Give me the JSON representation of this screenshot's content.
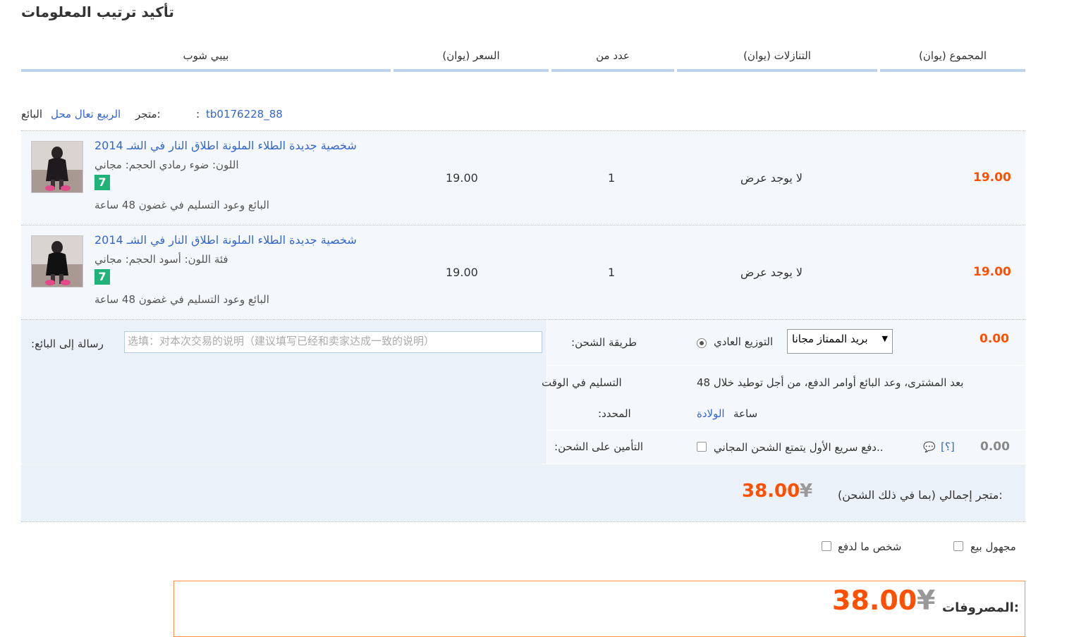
{
  "page_title": "تأكيد ترتيب المعلومات",
  "columns": {
    "total": "(المجموع (يوان",
    "discounts": "(التنازلات (يوان",
    "quantity": "عدد من",
    "price": "(السعر (يوان",
    "product": "بيبي شوب"
  },
  "seller": {
    "store_prefix": "متجر:",
    "store_name": "الربيع تعال محل",
    "seller_label": "البائع",
    "seller_id": "tb0176228_88",
    "colon": ":"
  },
  "items": [
    {
      "title": "شخصية جديدة الطلاء الملونة اطلاق النار في الشـ 2014",
      "attrs": "اللون: ضوء رمادي   الحجم: مجاني",
      "badge": "7",
      "note": "البائع وعود التسليم في غضون 48 ساعة",
      "price": "19.00",
      "quantity": "1",
      "discount": "لا يوجد عرض",
      "total": "19.00"
    },
    {
      "title": "شخصية جديدة الطلاء الملونة اطلاق النار في الشـ 2014",
      "attrs": "فئة اللون: أسود   الحجم: مجاني",
      "badge": "7",
      "note": "البائع وعود التسليم في غضون 48 ساعة",
      "price": "19.00",
      "quantity": "1",
      "discount": "لا يوجد عرض",
      "total": "19.00"
    }
  ],
  "message": {
    "label": ":رسالة إلى البائع",
    "placeholder": "选填：对本次交易的说明（建议填写已经和卖家达成一致的说明）"
  },
  "shipping": {
    "method_label": ":طريقة الشحن",
    "radio_label": "التوزيع العادي",
    "select_value": "بريد الممتاز مجانا",
    "cost": "0.00",
    "ontime_label_1": "التسليم في الوقت",
    "ontime_label_2": ":المحدد",
    "ontime_text_1": "بعد المشترى، وعد البائع أوامر الدفع، من أجل توطيد خلال 48",
    "ontime_text_2_plain": "ساعة",
    "ontime_text_2_link": "الولادة",
    "insurance_label": ":التأمين على الشحن",
    "insurance_text": "دفع سريع الأول يتمتع الشحن المجاني..",
    "insurance_help": "[؟]",
    "insurance_cost": "0.00"
  },
  "store_total": {
    "label": "متجر إجمالي (بما في ذلك الشحن):",
    "currency": "¥",
    "amount": "38.00"
  },
  "options": {
    "anonymous": "مجهول بيع",
    "pay_for_other": "شخص ما لدفع"
  },
  "payment": {
    "label": "المصروفات:",
    "currency": "¥",
    "amount": "38.00"
  },
  "colors": {
    "accent_orange": "#ff5000",
    "link_blue": "#3366cc",
    "header_bar": "#bcd4ea",
    "row_bg": "#f4f8fc",
    "badge_green": "#1fb37a"
  }
}
